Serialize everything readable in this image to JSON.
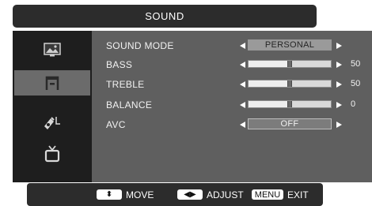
{
  "header": {
    "title": "SOUND"
  },
  "sidebar": {
    "items": [
      {
        "icon": "picture-icon",
        "active": false
      },
      {
        "icon": "sound-icon",
        "active": true
      },
      {
        "icon": "setup-icon",
        "active": false
      },
      {
        "icon": "tv-channel-icon",
        "active": false
      }
    ]
  },
  "menu": {
    "sound_mode": {
      "label": "SOUND MODE",
      "value": "PERSONAL"
    },
    "bass": {
      "label": "BASS",
      "value": "50",
      "level_percent": 50
    },
    "treble": {
      "label": "TREBLE",
      "value": "50",
      "level_percent": 50
    },
    "balance": {
      "label": "BALANCE",
      "value": "0",
      "level_percent": 50
    },
    "avc": {
      "label": "AVC",
      "value": "OFF"
    }
  },
  "help": {
    "move": {
      "key": "⬍",
      "label": "MOVE"
    },
    "adjust": {
      "key": "◀▶",
      "label": "ADJUST"
    },
    "exit": {
      "key": "MENU",
      "label": "EXIT"
    }
  },
  "colors": {
    "panel": "#5f5f5f",
    "sidebar": "#1e1e1e",
    "bar": "#2c2c2c",
    "active_item": "#6b6b6b"
  }
}
